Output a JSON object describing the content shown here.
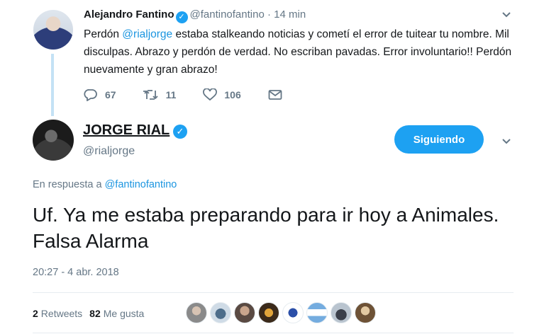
{
  "reply_tweet": {
    "name": "Alejandro Fantino",
    "handle": "@fantinofantino",
    "time": "· 14 min",
    "text_before": "Perdón ",
    "mention": "@rialjorge",
    "text_after": " estaba stalkeando noticias y cometí el error de tuitear tu nombre.  Mil disculpas.  Abrazo y perdón de verdad.  No escriban  pavadas.  Error involuntario!! Perdón nuevamente y gran abrazo!",
    "reply_count": "67",
    "retweet_count": "11",
    "like_count": "106"
  },
  "main_tweet": {
    "name": "JORGE RIAL",
    "handle": "@rialjorge",
    "follow_label": "Siguiendo",
    "in_reply_prefix": "En respuesta a ",
    "in_reply_handle": "@fantinofantino",
    "text": "Uf. Ya me estaba preparando para ir hoy a Animales. Falsa Alarma",
    "timestamp": "20:27 - 4 abr. 2018",
    "retweets_count": "2",
    "retweets_label": "Retweets",
    "likes_count": "82",
    "likes_label": "Me gusta"
  },
  "colors": {
    "accent": "#1da1f2",
    "link": "#1b95e0",
    "muted": "#657786"
  }
}
